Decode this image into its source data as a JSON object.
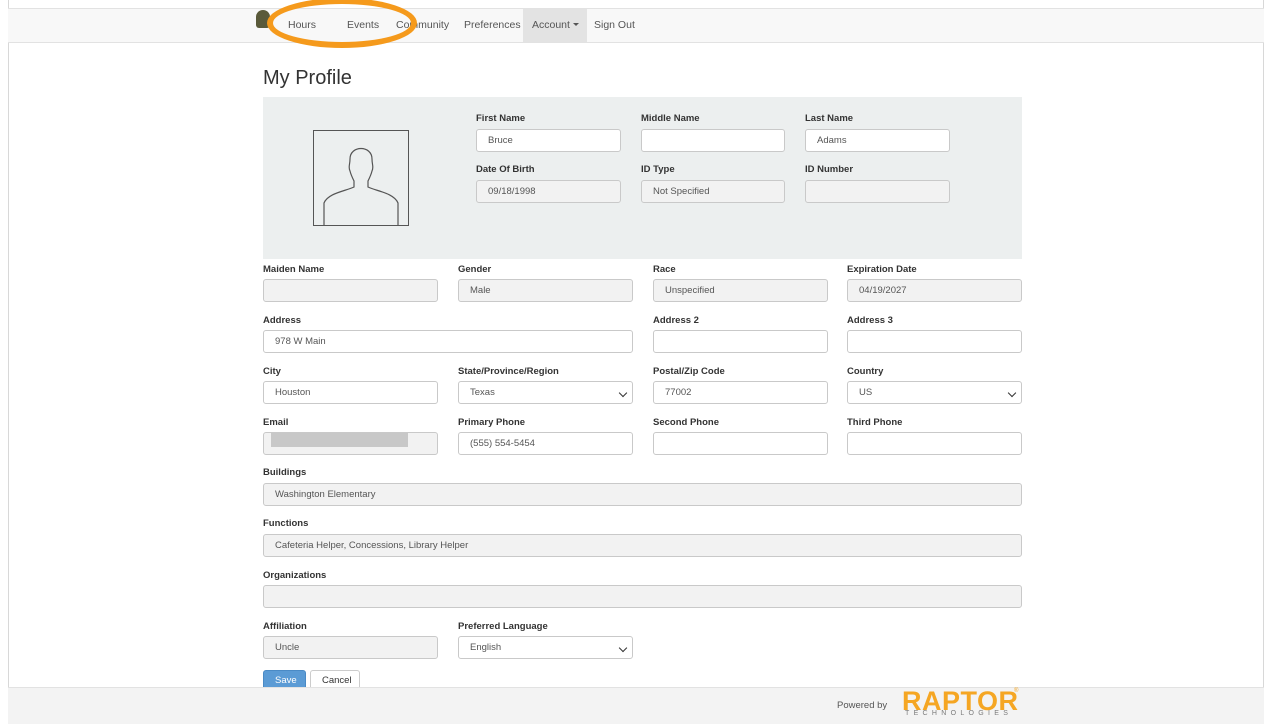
{
  "nav": {
    "items": [
      {
        "label": "Hours"
      },
      {
        "label": "Events"
      },
      {
        "label": "Community"
      },
      {
        "label": "Preferences"
      },
      {
        "label": "Account"
      },
      {
        "label": "Sign Out"
      }
    ]
  },
  "page": {
    "title": "My Profile"
  },
  "profile": {
    "first_name": {
      "label": "First Name",
      "value": "Bruce"
    },
    "middle_name": {
      "label": "Middle Name",
      "value": ""
    },
    "last_name": {
      "label": "Last Name",
      "value": "Adams"
    },
    "dob": {
      "label": "Date Of Birth",
      "value": "09/18/1998"
    },
    "id_type": {
      "label": "ID Type",
      "value": "Not Specified"
    },
    "id_number": {
      "label": "ID Number",
      "value": ""
    },
    "maiden_name": {
      "label": "Maiden Name",
      "value": ""
    },
    "gender": {
      "label": "Gender",
      "value": "Male"
    },
    "race": {
      "label": "Race",
      "value": "Unspecified"
    },
    "expiration": {
      "label": "Expiration Date",
      "value": "04/19/2027"
    },
    "address": {
      "label": "Address",
      "value": "978 W Main"
    },
    "address2": {
      "label": "Address 2",
      "value": ""
    },
    "address3": {
      "label": "Address 3",
      "value": ""
    },
    "city": {
      "label": "City",
      "value": "Houston"
    },
    "state": {
      "label": "State/Province/Region",
      "value": "Texas"
    },
    "postal": {
      "label": "Postal/Zip Code",
      "value": "77002"
    },
    "country": {
      "label": "Country",
      "value": "US"
    },
    "email": {
      "label": "Email",
      "value": ""
    },
    "primary_phone": {
      "label": "Primary Phone",
      "value": "(555) 554-5454"
    },
    "second_phone": {
      "label": "Second Phone",
      "value": ""
    },
    "third_phone": {
      "label": "Third Phone",
      "value": ""
    },
    "buildings": {
      "label": "Buildings",
      "value": "Washington Elementary"
    },
    "functions": {
      "label": "Functions",
      "value": "Cafeteria Helper, Concessions, Library Helper"
    },
    "organizations": {
      "label": "Organizations",
      "value": ""
    },
    "affiliation": {
      "label": "Affiliation",
      "value": "Uncle"
    },
    "language": {
      "label": "Preferred Language",
      "value": "English"
    }
  },
  "actions": {
    "save": "Save",
    "cancel": "Cancel"
  },
  "footer": {
    "powered_by": "Powered by",
    "brand": "RAPTOR",
    "brand_sub": "TECHNOLOGIES",
    "reg": "®"
  },
  "colors": {
    "accent_highlight": "#f59a1c",
    "save_button": "#5b9bd5",
    "brand": "#f5a623"
  }
}
